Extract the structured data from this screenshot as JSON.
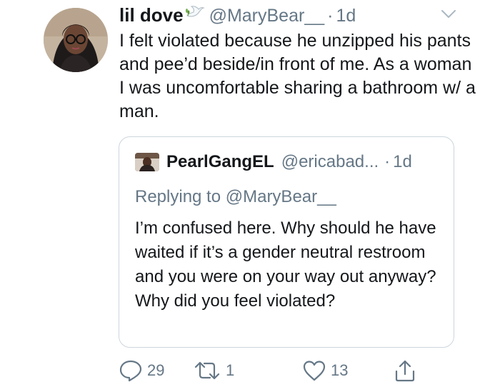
{
  "tweet": {
    "name": "lil dove",
    "handle": "@MaryBear__",
    "separator": "·",
    "time": "1d",
    "text": "I felt violated because he unzipped his pants and pee’d beside/in front of me. As a woman I was uncomfortable sharing a bathroom w/ a man."
  },
  "quote": {
    "name": "PearlGangEL",
    "handle": "@ericabad...",
    "separator": "·",
    "time": "1d",
    "replying_to": "Replying to @MaryBear__",
    "text": "I’m confused here. Why should he have waited if it’s a gender neutral restroom and you were on your way out anyway? Why did you feel violated?"
  },
  "actions": {
    "replies": "29",
    "retweets": "1",
    "likes": "13"
  },
  "icons": [
    "dove-emoji-icon",
    "chevron-down-icon",
    "reply-icon",
    "retweet-icon",
    "like-icon",
    "share-icon"
  ],
  "colors": {
    "text": "#14171a",
    "secondary": "#657786",
    "border": "#ccd6dd"
  }
}
